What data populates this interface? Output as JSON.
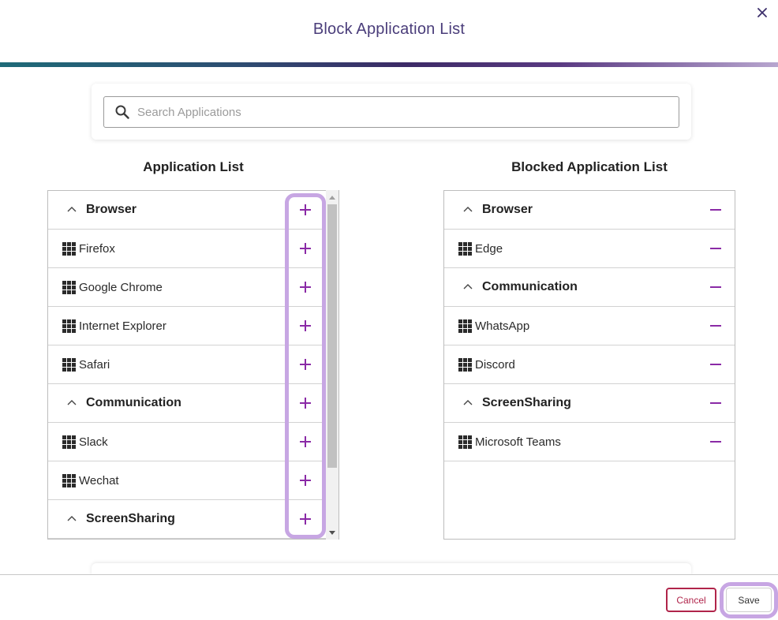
{
  "modal": {
    "title": "Block Application List"
  },
  "search": {
    "placeholder": "Search Applications"
  },
  "left": {
    "heading": "Application List",
    "rows": [
      {
        "type": "category",
        "label": "Browser"
      },
      {
        "type": "app",
        "label": "Firefox"
      },
      {
        "type": "app",
        "label": "Google Chrome"
      },
      {
        "type": "app",
        "label": "Internet Explorer"
      },
      {
        "type": "app",
        "label": "Safari"
      },
      {
        "type": "category",
        "label": "Communication"
      },
      {
        "type": "app",
        "label": "Slack"
      },
      {
        "type": "app",
        "label": "Wechat"
      },
      {
        "type": "category",
        "label": "ScreenSharing"
      }
    ]
  },
  "right": {
    "heading": "Blocked Application List",
    "rows": [
      {
        "type": "category",
        "label": "Browser"
      },
      {
        "type": "app",
        "label": "Edge"
      },
      {
        "type": "category",
        "label": "Communication"
      },
      {
        "type": "app",
        "label": "WhatsApp"
      },
      {
        "type": "app",
        "label": "Discord"
      },
      {
        "type": "category",
        "label": "ScreenSharing"
      },
      {
        "type": "app",
        "label": "Microsoft Teams"
      }
    ]
  },
  "footer": {
    "cancel_label": "Cancel",
    "save_label": "Save"
  },
  "icons": {
    "close": "close-icon",
    "search": "search-icon",
    "collapse": "chevron-up-icon",
    "app": "app-grid-icon",
    "add": "plus-icon",
    "remove": "minus-icon"
  },
  "colors": {
    "title": "#4a3d7a",
    "accent": "#8a2aa6",
    "highlight": "#c7a6e3",
    "cancel": "#b0244a"
  }
}
